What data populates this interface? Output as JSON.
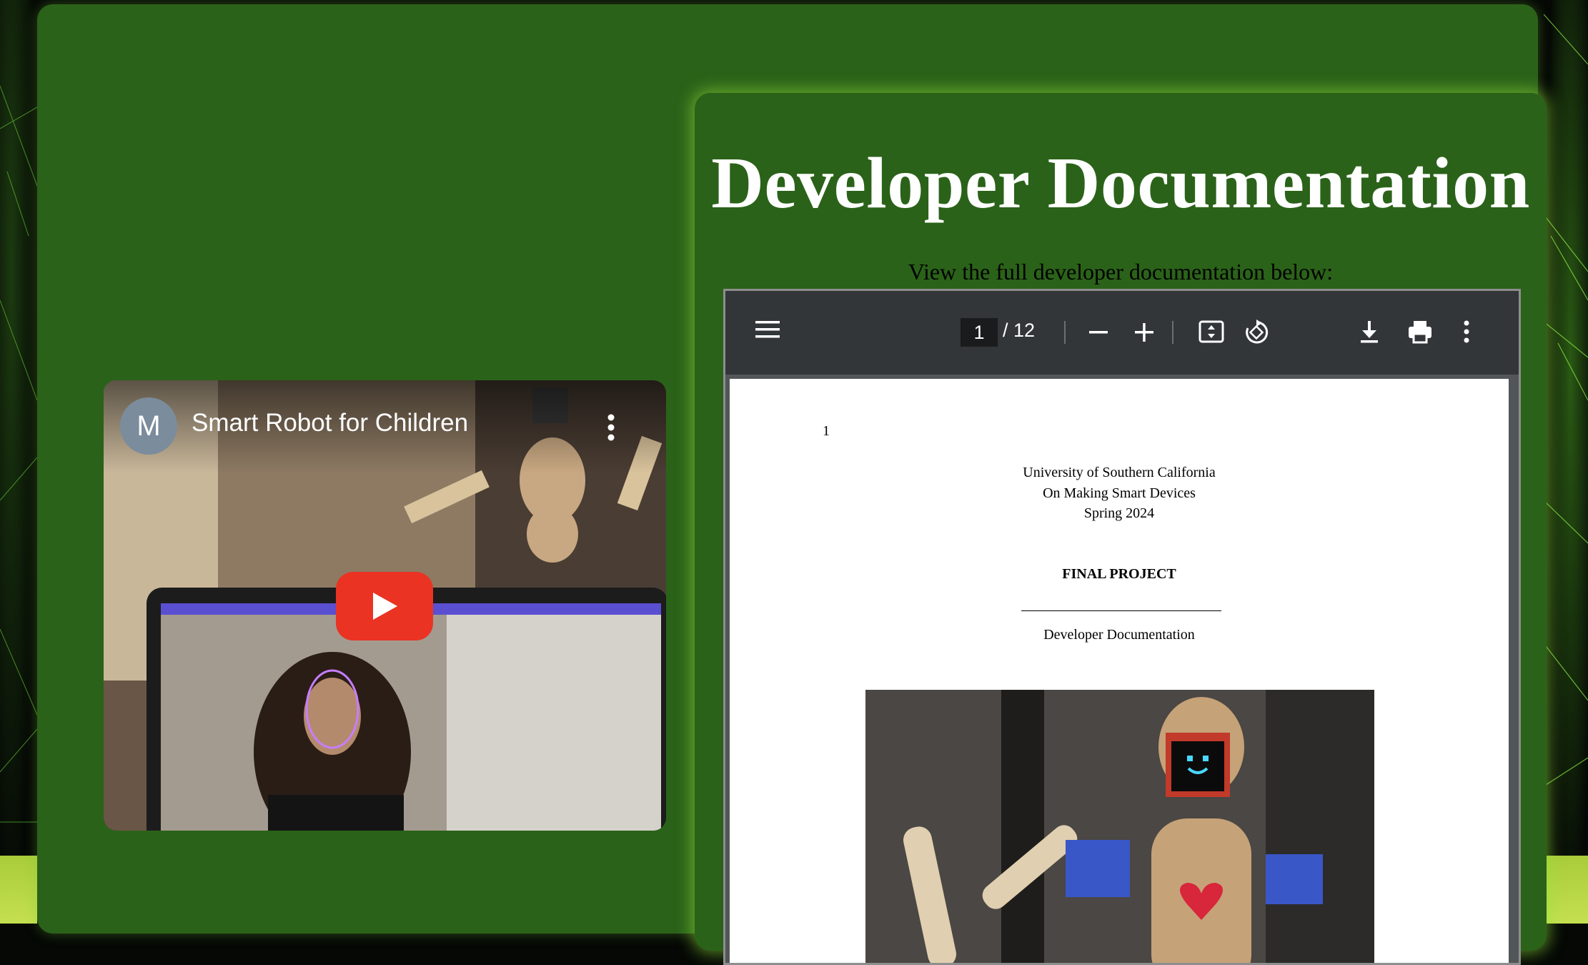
{
  "doc_section": {
    "title": "Developer Documentation",
    "subtitle": "View the full developer documentation below:"
  },
  "pdf_viewer": {
    "current_page": "1",
    "total_pages": "/ 12",
    "icons": [
      "menu-icon",
      "zoom-out-icon",
      "zoom-in-icon",
      "fit-page-icon",
      "rotate-icon",
      "download-icon",
      "print-icon",
      "more-options-icon"
    ],
    "page": {
      "page_number": "1",
      "institution": "University of Southern California",
      "course": "On Making Smart Devices",
      "term": "Spring 2024",
      "heading": "FINAL PROJECT",
      "doc_name": "Developer Documentation"
    }
  },
  "video": {
    "channel_initial": "M",
    "title": "Smart Robot for Children",
    "play_color": "#ea3323"
  },
  "colors": {
    "panel_green": "#2b6219",
    "glow": "#96e63c",
    "toolbar": "#323639"
  }
}
